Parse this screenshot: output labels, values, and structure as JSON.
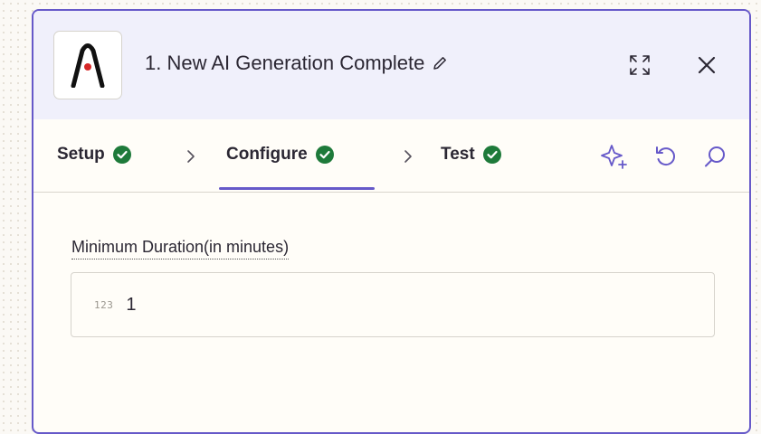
{
  "header": {
    "title": "1. New AI Generation Complete",
    "app_icon": "app-logo",
    "icons": [
      "pencil-icon",
      "expand-icon",
      "close-icon"
    ]
  },
  "steps": [
    {
      "label": "Setup",
      "status": "complete"
    },
    {
      "label": "Configure",
      "status": "complete",
      "active": true
    },
    {
      "label": "Test",
      "status": "complete"
    }
  ],
  "tools": [
    "ai-sparkle-icon",
    "reset-icon",
    "search-icon"
  ],
  "field": {
    "label": "Minimum Duration(in minutes)",
    "type_badge": "123",
    "value": "1"
  },
  "colors": {
    "accent": "#6659c9",
    "success": "#1e7a3a",
    "header_bg": "#f0f0fb",
    "text": "#2b2733"
  }
}
